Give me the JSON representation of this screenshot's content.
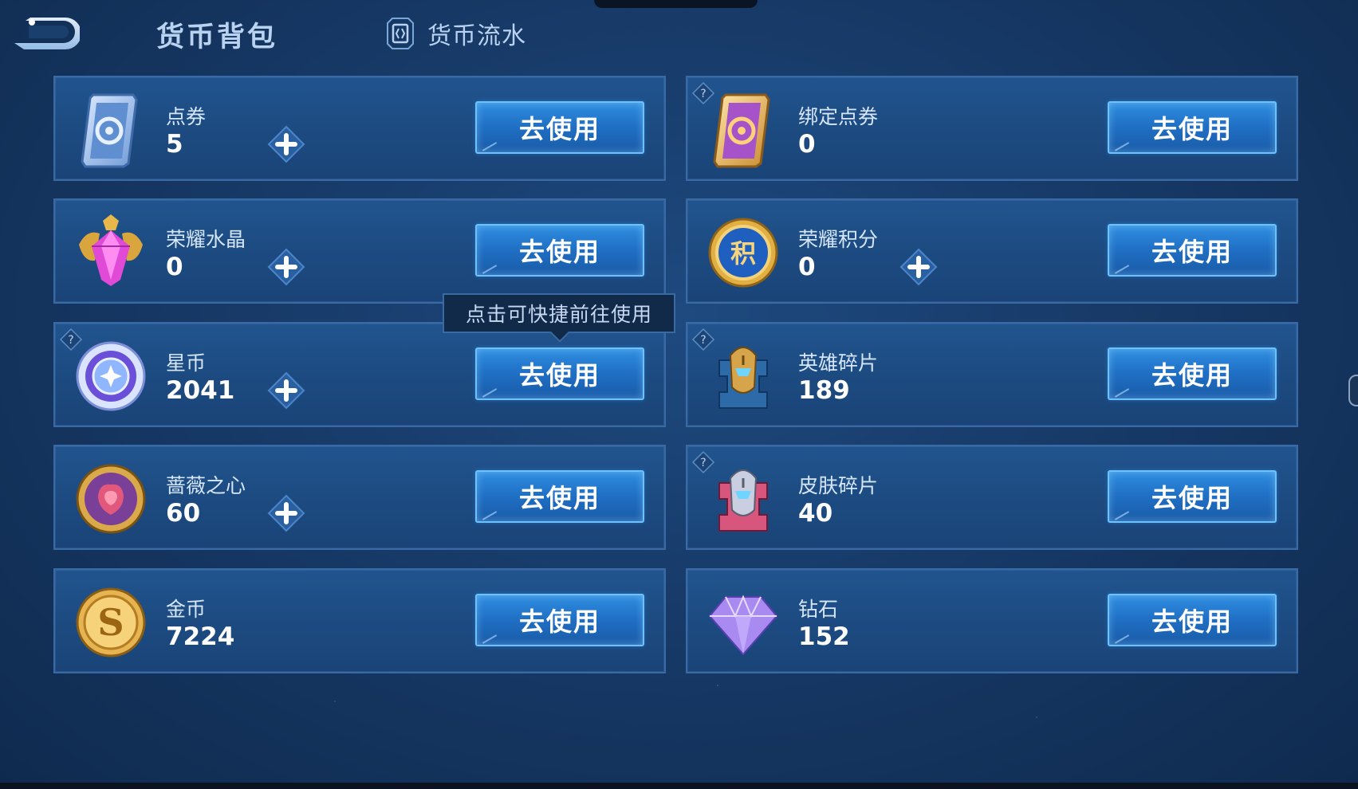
{
  "header": {
    "title": "货币背包",
    "flow_tab": "货币流水"
  },
  "tooltip": "点击可快捷前往使用",
  "use_label": "去使用",
  "items": [
    {
      "name": "点券",
      "amount": "5",
      "icon": "coupon-ticket-icon",
      "has_plus": true,
      "has_help": false
    },
    {
      "name": "绑定点券",
      "amount": "0",
      "icon": "bound-coupon-ticket-icon",
      "has_plus": false,
      "has_help": true
    },
    {
      "name": "荣耀水晶",
      "amount": "0",
      "icon": "glory-crystal-icon",
      "has_plus": true,
      "has_help": false
    },
    {
      "name": "荣耀积分",
      "amount": "0",
      "icon": "glory-points-icon",
      "has_plus": true,
      "has_help": false
    },
    {
      "name": "星币",
      "amount": "2041",
      "icon": "star-coin-icon",
      "has_plus": true,
      "has_help": true
    },
    {
      "name": "英雄碎片",
      "amount": "189",
      "icon": "hero-fragment-icon",
      "has_plus": false,
      "has_help": true
    },
    {
      "name": "蔷薇之心",
      "amount": "60",
      "icon": "rose-heart-icon",
      "has_plus": true,
      "has_help": false
    },
    {
      "name": "皮肤碎片",
      "amount": "40",
      "icon": "skin-fragment-icon",
      "has_plus": false,
      "has_help": true
    },
    {
      "name": "金币",
      "amount": "7224",
      "icon": "gold-coin-icon",
      "has_plus": false,
      "has_help": false
    },
    {
      "name": "钻石",
      "amount": "152",
      "icon": "diamond-icon",
      "has_plus": false,
      "has_help": false
    }
  ],
  "colors": {
    "background": "#173a68",
    "card": "#1f4d85",
    "button": "#2276cc",
    "button_border": "#6cc1ff",
    "title_text": "#b9d2ef"
  }
}
